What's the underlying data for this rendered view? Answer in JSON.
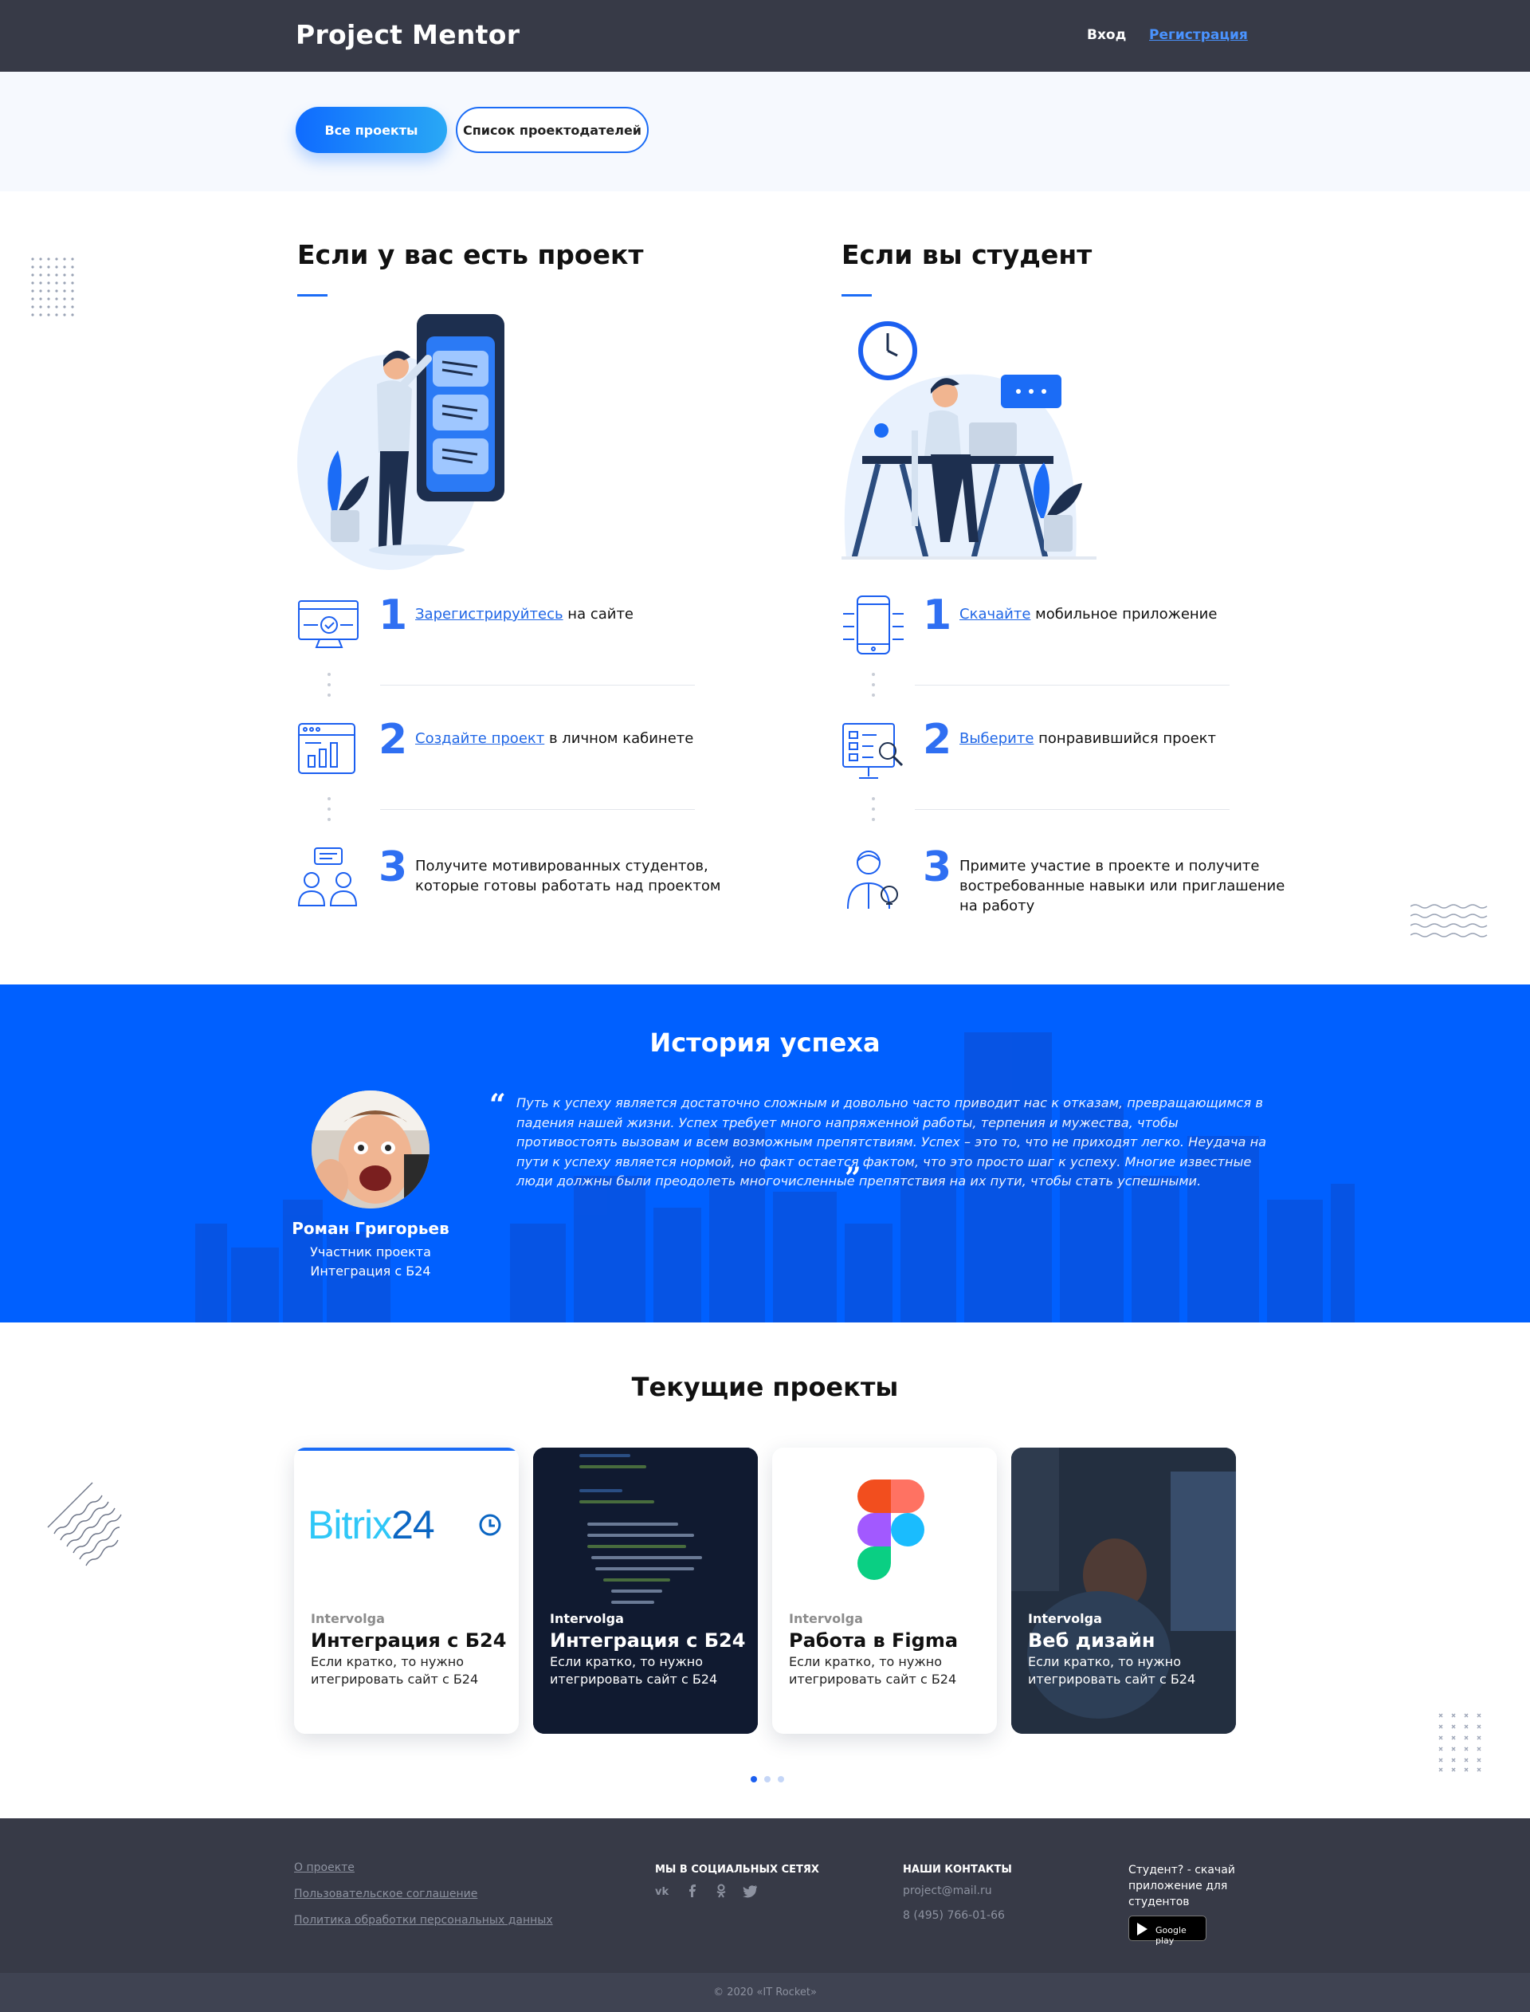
{
  "header": {
    "brand": "Project Mentor",
    "login": "Вход",
    "signup": "Регистрация"
  },
  "filters": {
    "all_projects": "Все проекты",
    "owners_list": "Список проектодателей"
  },
  "owner": {
    "heading": "Если у вас есть проект",
    "steps": [
      {
        "num": "1",
        "link": "Зарегистрируйтесь",
        "text": " на сайте"
      },
      {
        "num": "2",
        "link": "Создайте проект",
        "text": " в личном кабинете"
      },
      {
        "num": "3",
        "text": "Получите мотивированных студентов, которые готовы работать над проектом"
      }
    ]
  },
  "student": {
    "heading": "Если вы студент",
    "steps": [
      {
        "num": "1",
        "link": "Скачайте",
        "text": " мобильное приложение"
      },
      {
        "num": "2",
        "link": "Выберите",
        "text": " понравившийся проект"
      },
      {
        "num": "3",
        "text": "Примите участие в проекте и получите востребованные навыки или приглашение на работу"
      }
    ]
  },
  "story": {
    "title": "История успеха",
    "name": "Роман Григорьев",
    "role_line1": "Участник проекта",
    "role_line2": "Интеграция с Б24",
    "quote": "Путь к успеху является достаточно сложным и довольно часто приводит нас к отказам, превращающимся в падения нашей жизни. Успех требует много напряженной работы, терпения и мужества, чтобы противостоять вызовам и всем возможным препятствиям. Успех – это то, что не приходят легко. Неудача на пути к успеху является нормой, но факт остается фактом, что это просто шаг к успеху. Многие известные люди должны были преодолеть многочисленные препятствия на их пути, чтобы стать успешными."
  },
  "projects": {
    "title": "Текущие проекты",
    "cards": [
      {
        "company": "Intervolga",
        "title": "Интеграция с Б24",
        "desc": "Если кратко, то нужно итегрировать сайт с Б24",
        "logo_text": "Bitrix",
        "logo_num": "24"
      },
      {
        "company": "Intervolga",
        "title": "Интеграция с Б24",
        "desc": "Если кратко, то нужно итегрировать сайт с Б24"
      },
      {
        "company": "Intervolga",
        "title": "Работа в Figma",
        "desc": "Если кратко, то нужно итегрировать сайт с Б24"
      },
      {
        "company": "Intervolga",
        "title": "Веб дизайн",
        "desc": "Если кратко, то нужно итегрировать сайт с Б24"
      }
    ],
    "pager": {
      "pages": 3,
      "active": 1
    }
  },
  "footer": {
    "links": [
      "О проекте ",
      "Пользовательское соглашение ",
      "Политика обработки персональных данных"
    ],
    "social_heading": "МЫ В СОЦИАЛЬНЫХ СЕТЯХ",
    "social_icons": [
      "vk-icon",
      "facebook-icon",
      "odnoklassniki-icon",
      "twitter-icon"
    ],
    "contacts_heading": "НАШИ КОНТАКТЫ",
    "email": "project@mail.ru",
    "phone": "8 (495) 766-01-66",
    "app_text": "Студент? - скачай приложение для студентов",
    "store_badge": "Google play",
    "copyright": "© 2020 «IT Rocket»"
  },
  "colors": {
    "accent": "#1b6cf6",
    "header_bg": "#373a47",
    "story_bg": "#0060ff"
  }
}
